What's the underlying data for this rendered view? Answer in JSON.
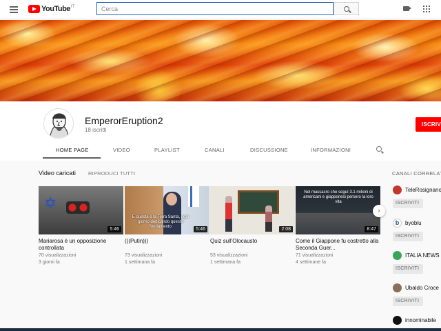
{
  "header": {
    "logo_text": "YouTube",
    "logo_country": "IT",
    "search_placeholder": "Cerca",
    "icons": [
      "menu-icon",
      "search-icon",
      "video-camera-icon",
      "apps-grid-icon"
    ]
  },
  "channel": {
    "name": "EmperorEruption2",
    "subscribers": "18 iscritti",
    "subscribe_label": "ISCRIVITI",
    "subscribe_color": "#ff0000"
  },
  "tabs": [
    {
      "label": "HOME PAGE",
      "active": true
    },
    {
      "label": "VIDEO"
    },
    {
      "label": "PLAYLIST"
    },
    {
      "label": "CANALI"
    },
    {
      "label": "DISCUSSIONE"
    },
    {
      "label": "INFORMAZIONI"
    }
  ],
  "section": {
    "title": "Video caricati",
    "play_all": "RIPRODUCI TUTTI"
  },
  "videos": [
    {
      "title": "Mariarosa è un opposizione controllata",
      "views": "70 visualizzazioni",
      "age": "3 giorni fa",
      "duration": "5:46"
    },
    {
      "title": "(((Putin)))",
      "views": "73 visualizzazioni",
      "age": "1 settimana fa",
      "duration": "5:46",
      "thumb_caption": "E questa è la Terra Santa, ogni giorno dedicando questo fondamento"
    },
    {
      "title": "Quiz sull'Olocausto",
      "views": "53 visualizzazioni",
      "age": "1 settimana fa",
      "duration": "2:08"
    },
    {
      "title": "Come il Giappone fu costretto alla Seconda Guer...",
      "views": "71 visualizzazioni",
      "age": "4 settimane fa",
      "duration": "8:47",
      "thumb_caption": "Nel massacro che seguì 3.1 milioni di americani e giapponesi persero la loro vita"
    }
  ],
  "related": {
    "title": "CANALI CORRELATI",
    "button_label": "ISCRIVITI",
    "channels": [
      {
        "name": "TeleRosignano",
        "color": "#c0392b"
      },
      {
        "name": "byoblu",
        "color": "#1e4fa0"
      },
      {
        "name": "ITALIA NEWS",
        "color": "#3aa55a"
      },
      {
        "name": "Ubaldo Croce",
        "color": "#8a6d5a"
      },
      {
        "name": "innominabile",
        "color": "#111111"
      }
    ]
  }
}
